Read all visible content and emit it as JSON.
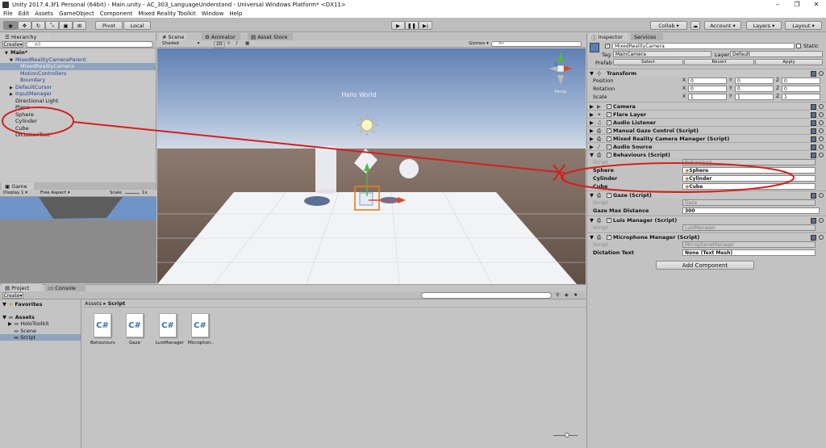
{
  "window": {
    "title": "Unity 2017.4.3f1 Personal (64bit) - Main.unity - AC_303_LanguageUnderstand - Universal Windows Platform* <DX11>"
  },
  "menu": [
    "File",
    "Edit",
    "Assets",
    "GameObject",
    "Component",
    "Mixed Reality Toolkit",
    "Window",
    "Help"
  ],
  "toolbar": {
    "pivot": "Pivot",
    "local": "Local",
    "collab": "Collab",
    "account": "Account",
    "layers": "Layers",
    "layout": "Layout"
  },
  "hierarchy": {
    "tab": "Hierarchy",
    "create": "Create",
    "search_hint": "All",
    "items": [
      {
        "label": "Main*",
        "indent": 0,
        "arrow": "▼",
        "bold": true
      },
      {
        "label": "MixedRealityCameraParent",
        "indent": 1,
        "arrow": "▼",
        "blue": true
      },
      {
        "label": "MixedRealityCamera",
        "indent": 2,
        "arrow": "",
        "blue": true,
        "selected": true
      },
      {
        "label": "MotionControllers",
        "indent": 2,
        "arrow": "",
        "blue": true
      },
      {
        "label": "Boundary",
        "indent": 2,
        "arrow": "",
        "blue": true
      },
      {
        "label": "DefaultCursor",
        "indent": 1,
        "arrow": "▶",
        "blue": true
      },
      {
        "label": "InputManager",
        "indent": 1,
        "arrow": "▶",
        "blue": true
      },
      {
        "label": "Directional Light",
        "indent": 1,
        "arrow": ""
      },
      {
        "label": "Plane",
        "indent": 1,
        "arrow": ""
      },
      {
        "label": "Sphere",
        "indent": 1,
        "arrow": ""
      },
      {
        "label": "Cylinder",
        "indent": 1,
        "arrow": ""
      },
      {
        "label": "Cube",
        "indent": 1,
        "arrow": ""
      },
      {
        "label": "DictationText",
        "indent": 1,
        "arrow": ""
      }
    ]
  },
  "scene": {
    "tab": "Scene",
    "tab2": "Animator",
    "tab3": "Asset Store",
    "shading": "Shaded",
    "mode2d": "2D",
    "gizmos": "Gizmos",
    "search_hint": "All",
    "label": "Hello World",
    "persp": "Persp"
  },
  "game": {
    "tab": "Game",
    "display": "Display 1",
    "aspect": "Free Aspect",
    "scale_label": "Scale",
    "scale_value": "1x"
  },
  "project": {
    "tab": "Project",
    "tab2": "Console",
    "create": "Create",
    "favorites": "Favorites",
    "assets": "Assets",
    "folders": [
      "HoloToolkit",
      "Scene",
      "Script"
    ],
    "breadcrumb_root": "Assets",
    "breadcrumb_leaf": "Script",
    "files": [
      "Behaviours",
      "Gaze",
      "LuisManager",
      "Microphon.."
    ]
  },
  "inspector": {
    "tab": "Inspector",
    "tab2": "Services",
    "object_name": "MixedRealityCamera",
    "static": "Static",
    "tag_label": "Tag",
    "tag_value": "MainCamera",
    "layer_label": "Layer",
    "layer_value": "Default",
    "prefab_label": "Prefab",
    "prefab_select": "Select",
    "prefab_revert": "Revert",
    "prefab_apply": "Apply",
    "transform": {
      "title": "Transform",
      "rows": [
        {
          "label": "Position",
          "x": "0",
          "y": "0",
          "z": "0"
        },
        {
          "label": "Rotation",
          "x": "0",
          "y": "0",
          "z": "0"
        },
        {
          "label": "Scale",
          "x": "1",
          "y": "1",
          "z": "1"
        }
      ]
    },
    "components": [
      "Camera",
      "Flare Layer",
      "Audio Listener",
      "Manual Gaze Control (Script)",
      "Mixed Reality Camera Manager (Script)",
      "Audio Source"
    ],
    "behaviours": {
      "title": "Behaviours (Script)",
      "script_label": "Script",
      "script_value": "Behaviours",
      "fields": [
        {
          "label": "Sphere",
          "value": "Sphere"
        },
        {
          "label": "Cylinder",
          "value": "Cylinder"
        },
        {
          "label": "Cube",
          "value": "Cube"
        }
      ]
    },
    "gaze": {
      "title": "Gaze (Script)",
      "script_label": "Script",
      "script_value": "Gaze",
      "dist_label": "Gaze Max Distance",
      "dist_value": "300"
    },
    "luis": {
      "title": "Luis Manager (Script)",
      "script_label": "Script",
      "script_value": "LuisManager"
    },
    "mic": {
      "title": "Microphone Manager (Script)",
      "script_label": "Script",
      "script_value": "MicrophoneManager",
      "dict_label": "Dictation Text",
      "dict_value": "None (Text Mesh)"
    },
    "add_component": "Add Component"
  },
  "colors": {
    "annotation": "#d42020",
    "selection": "#3d7ee0",
    "sky": "#6b88b6",
    "ground": "#7b6a5e"
  }
}
